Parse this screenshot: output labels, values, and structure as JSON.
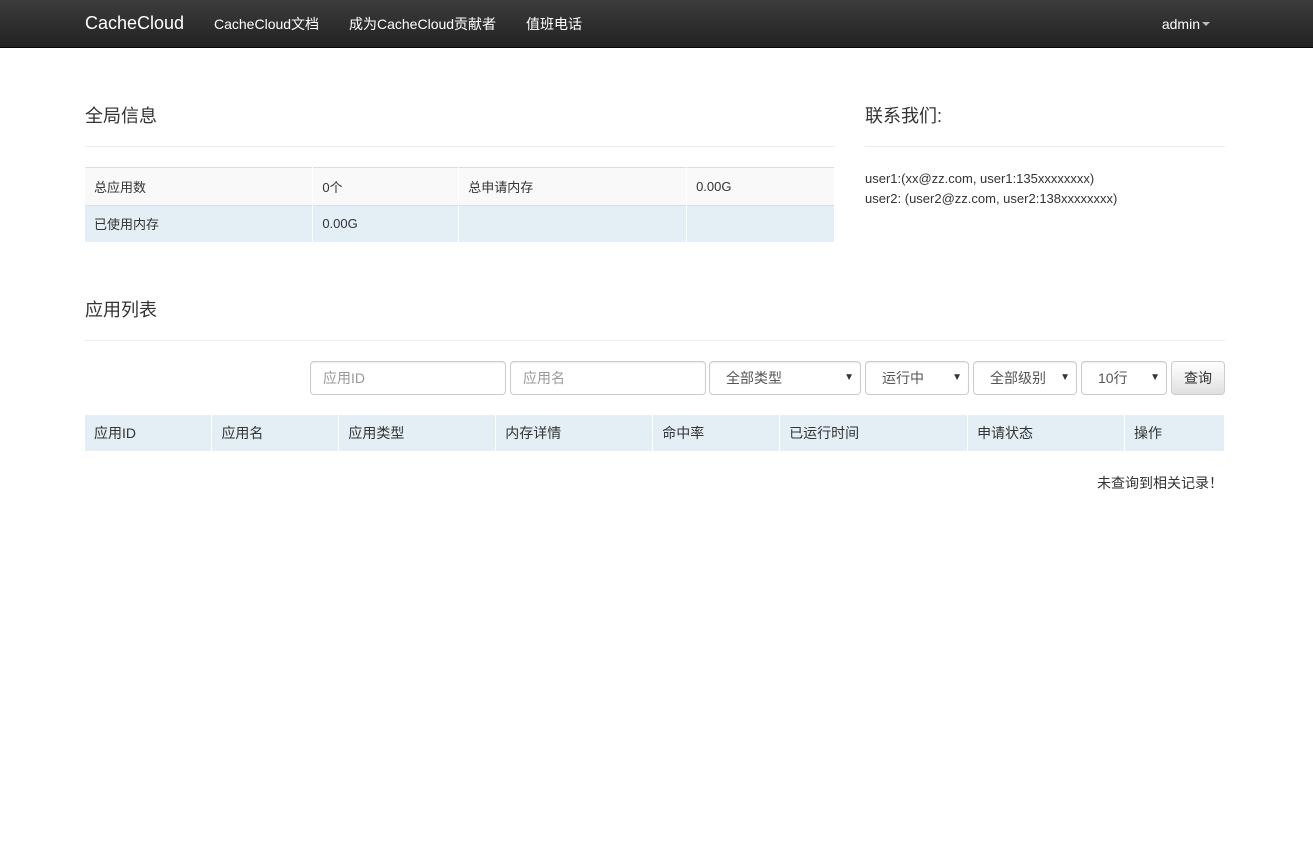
{
  "navbar": {
    "brand": "CacheCloud",
    "links": [
      "CacheCloud文档",
      "成为CacheCloud贡献者",
      "值班电话"
    ],
    "user": "admin"
  },
  "global": {
    "title": "全局信息",
    "rows": [
      [
        "总应用数",
        "0个",
        "总申请内存",
        "0.00G"
      ],
      [
        "已使用内存",
        "0.00G",
        "",
        ""
      ]
    ]
  },
  "contact": {
    "title": "联系我们:",
    "lines": [
      "user1:(xx@zz.com, user1:135xxxxxxxx)",
      "user2: (user2@zz.com, user2:138xxxxxxxx)"
    ]
  },
  "apps": {
    "title": "应用列表",
    "filters": {
      "app_id_placeholder": "应用ID",
      "app_name_placeholder": "应用名",
      "type_selected": "全部类型",
      "status_selected": "运行中",
      "level_selected": "全部级别",
      "rows_selected": "10行",
      "query_label": "查询"
    },
    "columns": [
      "应用ID",
      "应用名",
      "应用类型",
      "内存详情",
      "命中率",
      "已运行时间",
      "申请状态",
      "操作"
    ],
    "empty_message": "未查询到相关记录！"
  }
}
